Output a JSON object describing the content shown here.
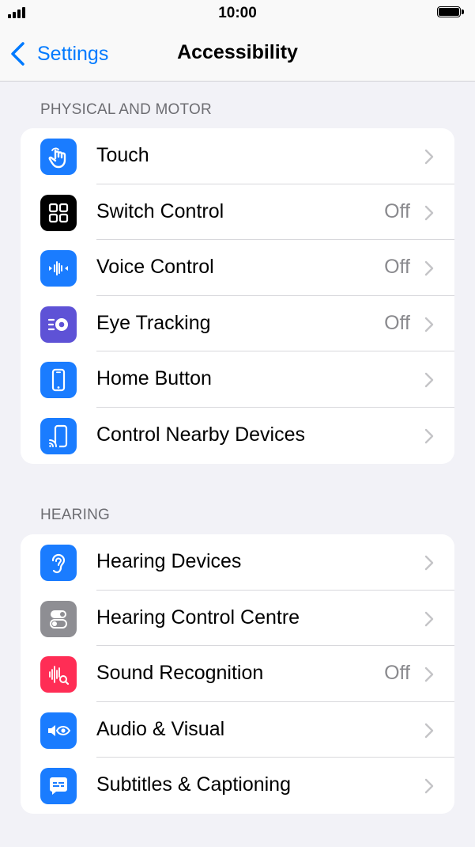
{
  "status_bar": {
    "time": "10:00"
  },
  "nav": {
    "back_label": "Settings",
    "title": "Accessibility"
  },
  "sections": [
    {
      "header": "PHYSICAL AND MOTOR",
      "items": [
        {
          "label": "Touch",
          "value": "",
          "icon": "touch-icon",
          "color": "#1a7cff"
        },
        {
          "label": "Switch Control",
          "value": "Off",
          "icon": "switch-control-icon",
          "color": "#000000"
        },
        {
          "label": "Voice Control",
          "value": "Off",
          "icon": "voice-control-icon",
          "color": "#1a7cff"
        },
        {
          "label": "Eye Tracking",
          "value": "Off",
          "icon": "eye-tracking-icon",
          "color": "#5e52d6"
        },
        {
          "label": "Home Button",
          "value": "",
          "icon": "home-button-icon",
          "color": "#1a7cff"
        },
        {
          "label": "Control Nearby Devices",
          "value": "",
          "icon": "control-nearby-devices-icon",
          "color": "#1a7cff"
        }
      ]
    },
    {
      "header": "HEARING",
      "items": [
        {
          "label": "Hearing Devices",
          "value": "",
          "icon": "hearing-devices-icon",
          "color": "#1a7cff"
        },
        {
          "label": "Hearing Control Centre",
          "value": "",
          "icon": "hearing-control-centre-icon",
          "color": "#8e8e93"
        },
        {
          "label": "Sound Recognition",
          "value": "Off",
          "icon": "sound-recognition-icon",
          "color": "#ff2d55"
        },
        {
          "label": "Audio & Visual",
          "value": "",
          "icon": "audio-visual-icon",
          "color": "#1a7cff"
        },
        {
          "label": "Subtitles & Captioning",
          "value": "",
          "icon": "subtitles-captioning-icon",
          "color": "#1a7cff"
        }
      ]
    }
  ]
}
